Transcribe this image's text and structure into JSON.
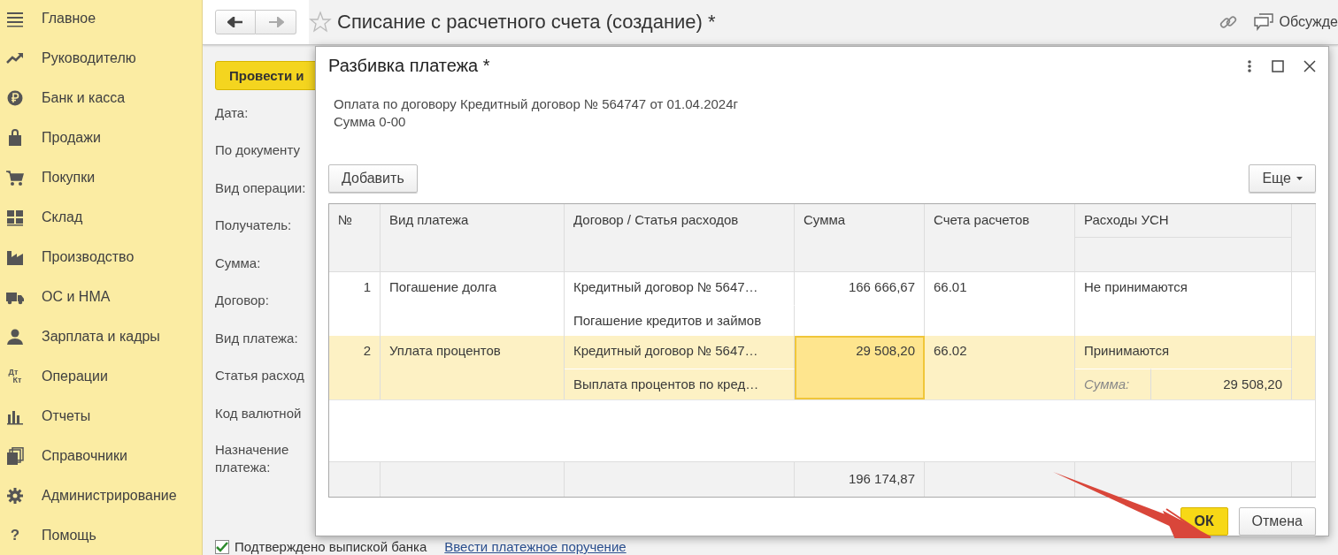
{
  "sidebar": {
    "items": [
      {
        "label": "Главное"
      },
      {
        "label": "Руководителю"
      },
      {
        "label": "Банк и касса"
      },
      {
        "label": "Продажи"
      },
      {
        "label": "Покупки"
      },
      {
        "label": "Склад"
      },
      {
        "label": "Производство"
      },
      {
        "label": "ОС и НМА"
      },
      {
        "label": "Зарплата и кадры"
      },
      {
        "label": "Операции",
        "icon_text": [
          "Дт",
          "Кт"
        ]
      },
      {
        "label": "Отчеты"
      },
      {
        "label": "Справочники"
      },
      {
        "label": "Администрирование"
      },
      {
        "label": "Помощь",
        "icon_text": [
          "?"
        ]
      }
    ]
  },
  "document": {
    "title": "Списание с расчетного счета (создание) *",
    "discuss": "Обсужде",
    "post_button": "Провести и",
    "fields": [
      "Дата:",
      "По документу",
      "Вид операции:",
      "Получатель:",
      "Сумма:",
      "Договор:",
      "Вид платежа:",
      "Статья расход",
      "Код валютной",
      "Назначение платежа:"
    ],
    "confirmed": {
      "label": "Подтверждено выпиской банка",
      "checked": true
    },
    "link": "Ввести платежное поручение"
  },
  "dialog": {
    "title": "Разбивка платежа *",
    "description": [
      "Оплата по договору Кредитный договор № 564747 от 01.04.2024г",
      "Сумма 0-00"
    ],
    "add_button": "Добавить",
    "more_button": "Еще",
    "table": {
      "columns": [
        "№",
        "Вид платежа",
        "Договор / Статья расходов",
        "Сумма",
        "Счета расчетов",
        "Расходы УСН"
      ],
      "rows": [
        {
          "number": "1",
          "payment_type": "Погашение долга",
          "contract": "Кредитный договор № 5647…",
          "expense_item": "Погашение кредитов и займов",
          "sum": "166 666,67",
          "account": "66.01",
          "usn": "Не принимаются",
          "selected": false
        },
        {
          "number": "2",
          "payment_type": "Уплата процентов",
          "contract": "Кредитный договор № 5647…",
          "expense_item": "Выплата процентов по кред…",
          "sum": "29 508,20",
          "account": "66.02",
          "usn": "Принимаются",
          "usn_sum_label": "Сумма:",
          "usn_sum": "29 508,20",
          "selected": true
        }
      ],
      "total": "196 174,87"
    },
    "ok_button": "ОК",
    "cancel_button": "Отмена"
  }
}
